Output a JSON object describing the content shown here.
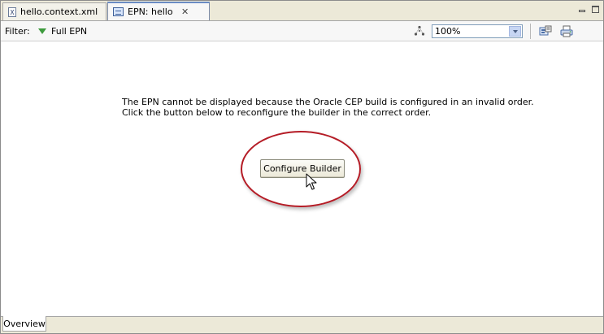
{
  "tabs": [
    {
      "label": "hello.context.xml",
      "icon": "xml-file-icon"
    },
    {
      "label": "EPN: hello",
      "icon": "epn-diagram-icon"
    }
  ],
  "window_controls": {
    "minimize": "minimize-icon",
    "maximize": "maximize-icon"
  },
  "toolbar": {
    "filter_label": "Filter:",
    "filter_value": "Full EPN",
    "zoom_value": "100%"
  },
  "canvas": {
    "message_line1": "The EPN cannot be displayed because the Oracle CEP build is configured in an invalid order.",
    "message_line2": "Click the button below to reconfigure the builder in the correct order.",
    "configure_button_label": "Configure Builder",
    "highlight_color": "#b51c26"
  },
  "bottom_tabs": [
    {
      "label": "Overview"
    }
  ]
}
